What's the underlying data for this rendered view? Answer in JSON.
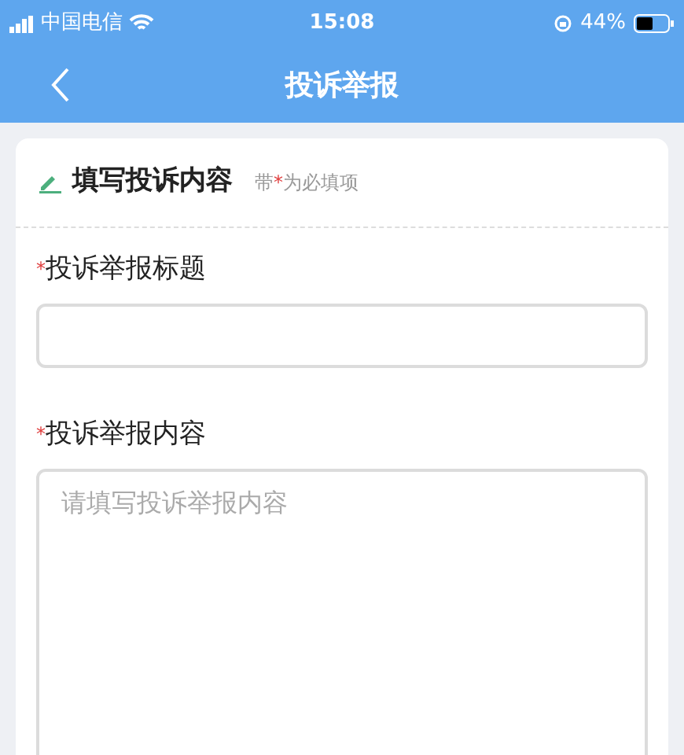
{
  "status_bar": {
    "carrier": "中国电信",
    "time": "15:08",
    "battery": "44%"
  },
  "nav": {
    "title": "投诉举报"
  },
  "section": {
    "title": "填写投诉内容",
    "hint": {
      "before": "带",
      "mark": "*",
      "after": "为必填项"
    }
  },
  "fields": [
    {
      "kind": "input",
      "required_mark": "*",
      "label": "投诉举报标题"
    },
    {
      "kind": "textarea",
      "required_mark": "*",
      "label": "投诉举报内容",
      "placeholder": "请填写投诉举报内容"
    }
  ]
}
